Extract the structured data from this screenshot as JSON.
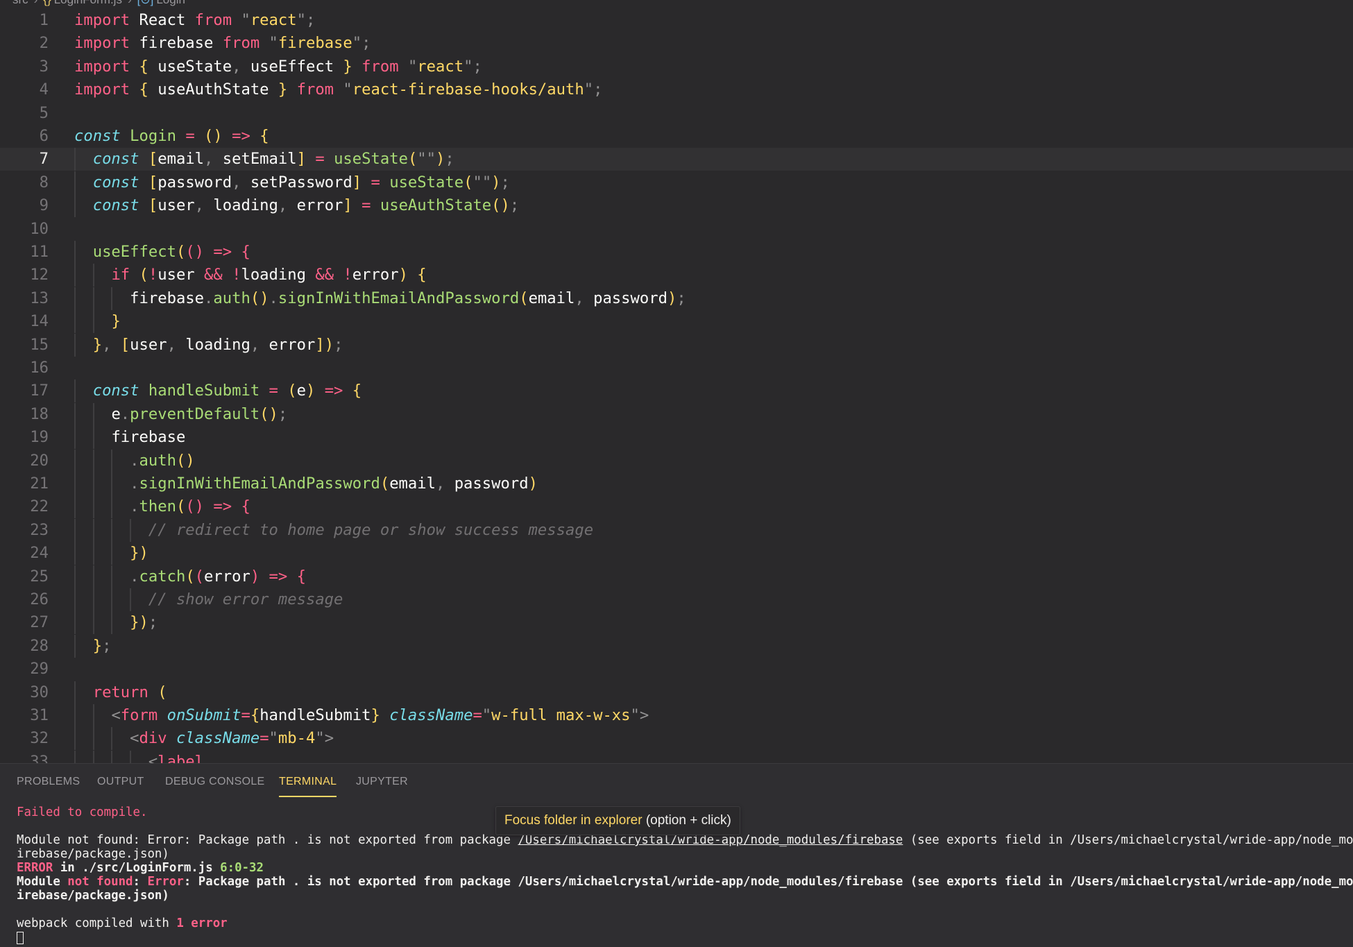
{
  "breadcrumb": {
    "folder": "src",
    "file_icon": "{}",
    "file": "LoginForm.js",
    "symbol_icon": "[⊙]",
    "symbol": "Login"
  },
  "editor": {
    "active_line": "7",
    "lines": [
      {
        "n": "1",
        "t": "import React from \"react\";"
      },
      {
        "n": "2",
        "t": "import firebase from \"firebase\";"
      },
      {
        "n": "3",
        "t": "import { useState, useEffect } from \"react\";"
      },
      {
        "n": "4",
        "t": "import { useAuthState } from \"react-firebase-hooks/auth\";"
      },
      {
        "n": "5",
        "t": ""
      },
      {
        "n": "6",
        "t": "const Login = () => {"
      },
      {
        "n": "7",
        "t": "  const [email, setEmail] = useState(\"\");"
      },
      {
        "n": "8",
        "t": "  const [password, setPassword] = useState(\"\");"
      },
      {
        "n": "9",
        "t": "  const [user, loading, error] = useAuthState();"
      },
      {
        "n": "10",
        "t": ""
      },
      {
        "n": "11",
        "t": "  useEffect(() => {"
      },
      {
        "n": "12",
        "t": "    if (!user && !loading && !error) {"
      },
      {
        "n": "13",
        "t": "      firebase.auth().signInWithEmailAndPassword(email, password);"
      },
      {
        "n": "14",
        "t": "    }"
      },
      {
        "n": "15",
        "t": "  }, [user, loading, error]);"
      },
      {
        "n": "16",
        "t": ""
      },
      {
        "n": "17",
        "t": "  const handleSubmit = (e) => {"
      },
      {
        "n": "18",
        "t": "    e.preventDefault();"
      },
      {
        "n": "19",
        "t": "    firebase"
      },
      {
        "n": "20",
        "t": "      .auth()"
      },
      {
        "n": "21",
        "t": "      .signInWithEmailAndPassword(email, password)"
      },
      {
        "n": "22",
        "t": "      .then(() => {"
      },
      {
        "n": "23",
        "t": "        // redirect to home page or show success message"
      },
      {
        "n": "24",
        "t": "      })"
      },
      {
        "n": "25",
        "t": "      .catch((error) => {"
      },
      {
        "n": "26",
        "t": "        // show error message"
      },
      {
        "n": "27",
        "t": "      });"
      },
      {
        "n": "28",
        "t": "  };"
      },
      {
        "n": "29",
        "t": ""
      },
      {
        "n": "30",
        "t": "  return ("
      },
      {
        "n": "31",
        "t": "    <form onSubmit={handleSubmit} className=\"w-full max-w-xs\">"
      },
      {
        "n": "32",
        "t": "      <div className=\"mb-4\">"
      },
      {
        "n": "33",
        "t": "        <label"
      }
    ]
  },
  "panel": {
    "tabs": [
      {
        "label": "PROBLEMS",
        "active": false
      },
      {
        "label": "OUTPUT",
        "active": false
      },
      {
        "label": "DEBUG CONSOLE",
        "active": false
      },
      {
        "label": "TERMINAL",
        "active": true
      },
      {
        "label": "JUPYTER",
        "active": false
      }
    ],
    "terminal": {
      "failed": "Failed to compile.",
      "err1_prefix": "Module not found: Error: Package path . is not exported from package ",
      "err1_link": "/Users/michaelcrystal/wride-app/node_modules/firebase",
      "err1_suffix": " (see exports field in /Users/michaelcrystal/wride-app/node_modules/f",
      "err1_cont": "irebase/package.json)",
      "err2_label": "ERROR",
      "err2_in": " in ./src/LoginForm.js ",
      "err2_loc": "6:0-32",
      "err3_module": "Module ",
      "err3_notfound": "not found",
      "err3_colon": ": ",
      "err3_error": "Error",
      "err3_rest": ": Package path . is not exported from package /Users/michaelcrystal/wride-app/node_modules/firebase (see exports field in /Users/michaelcrystal/wride-app/node_modules/f",
      "err3_cont": "irebase/package.json)",
      "webpack_prefix": "webpack compiled with ",
      "webpack_count": "1 error"
    }
  },
  "tooltip": {
    "action": "Focus folder in explorer",
    "hint": " (option + click)"
  },
  "colors": {
    "keyword": "#ff6188",
    "string": "#ffd866",
    "function": "#a9dc76",
    "storage": "#78dce8",
    "comment": "#727072",
    "active_tab": "#ffd866"
  }
}
